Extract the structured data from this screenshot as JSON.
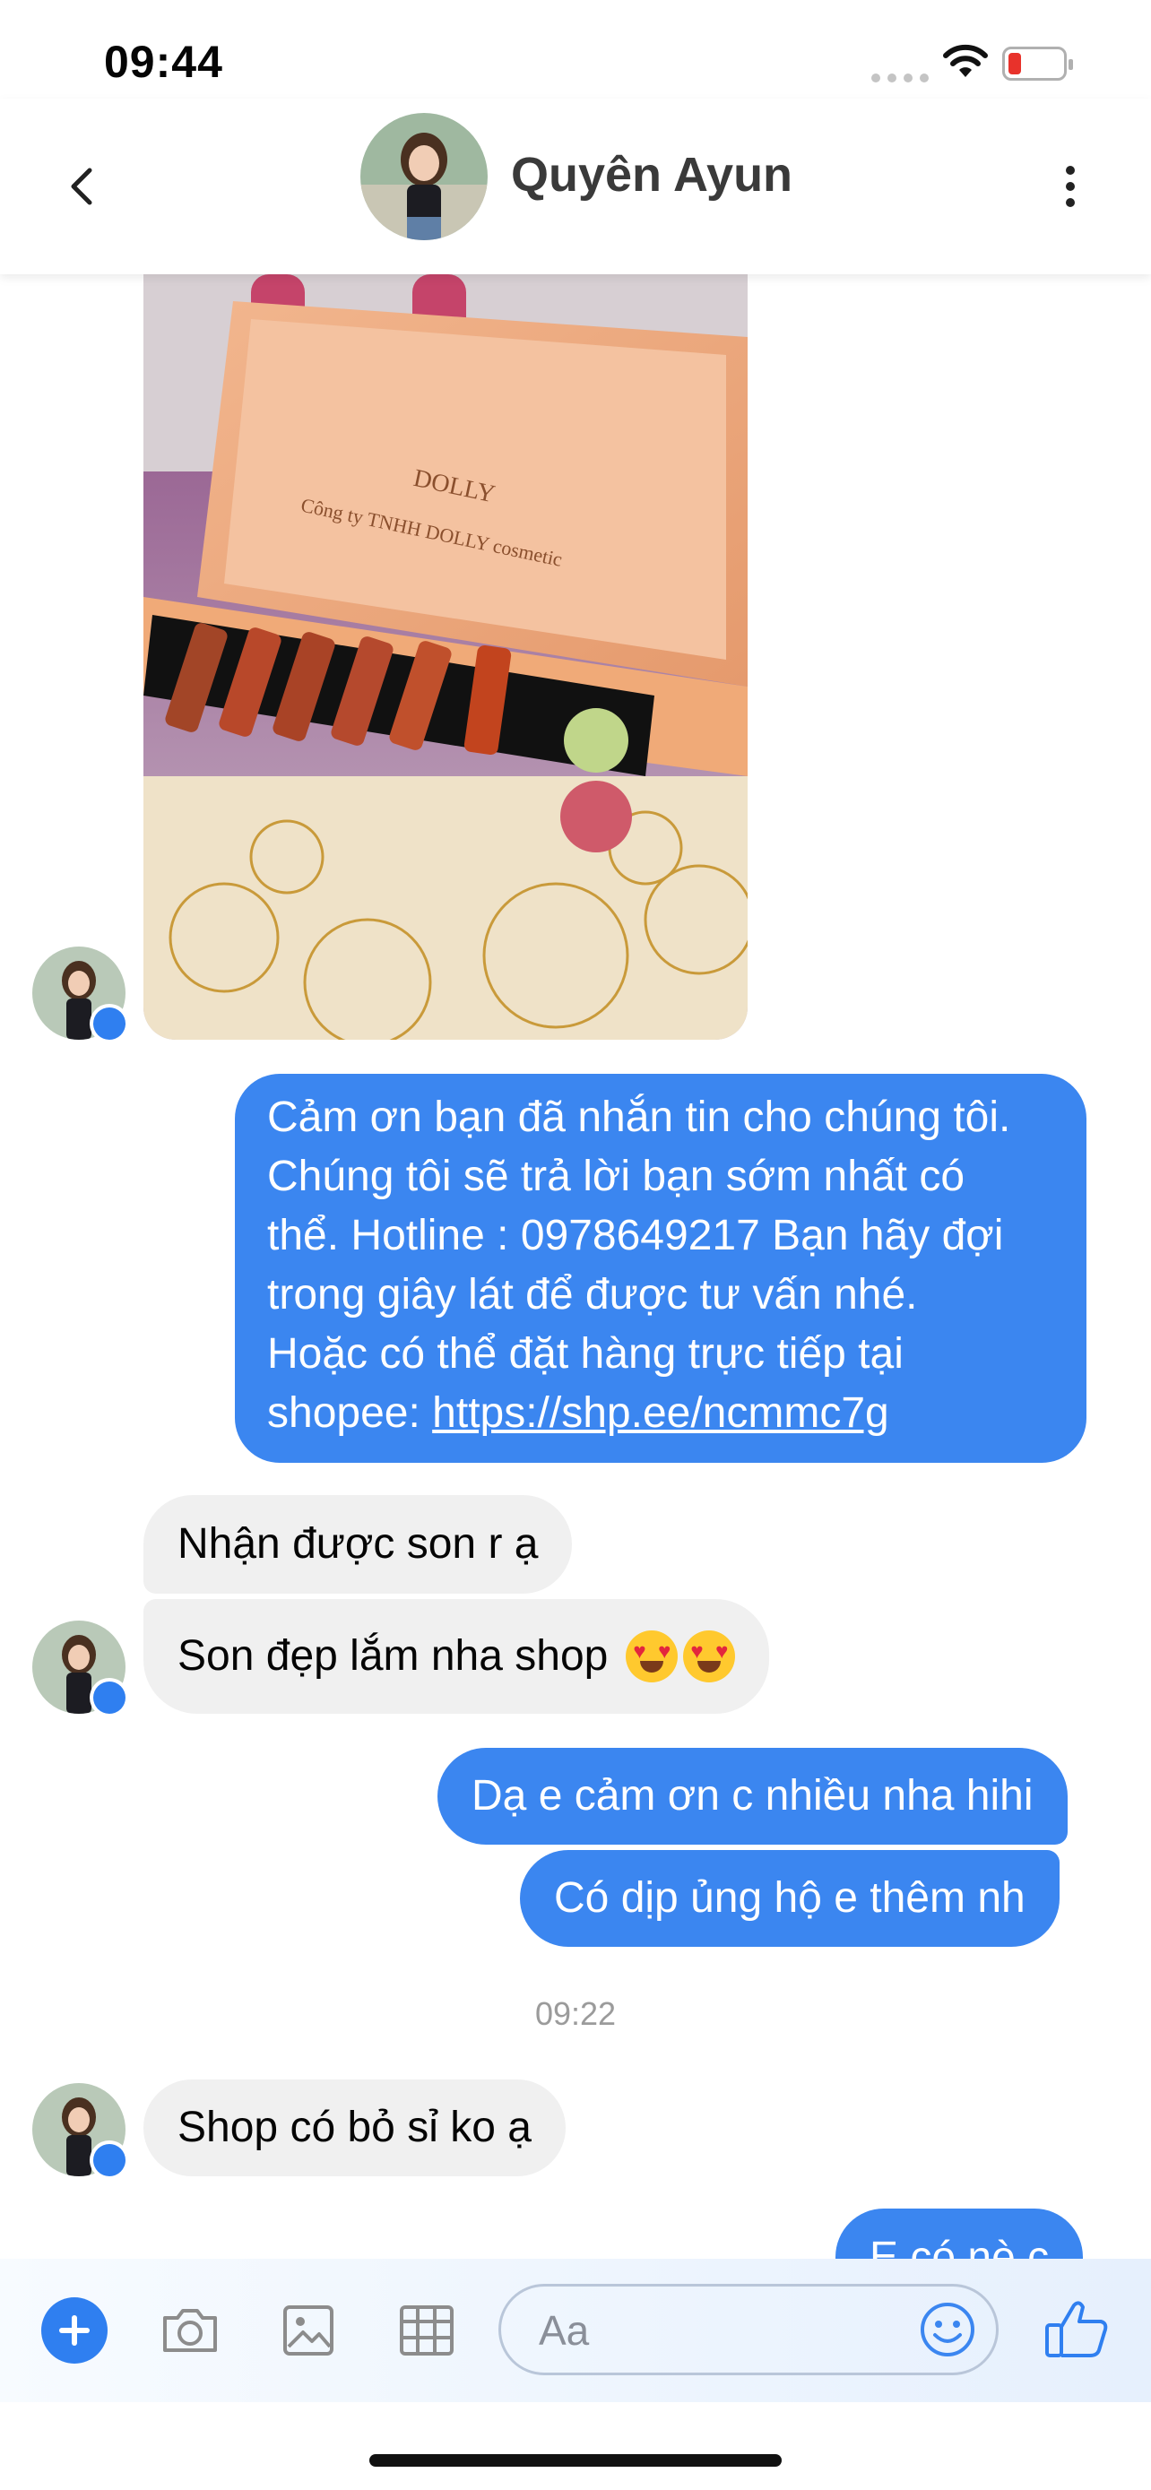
{
  "status_bar": {
    "time": "09:44"
  },
  "header": {
    "contact_name": "Quyên Ayun",
    "back_icon": "chevron-left-icon",
    "more_icon": "vertical-dots-icon"
  },
  "photo": {
    "brand_text": "DOLLY",
    "box_text": "Công ty TNHH DOLLY cosmetic"
  },
  "messages": {
    "m1": {
      "lines": [
        "Cảm ơn bạn đã nhắn tin cho chúng tôi.",
        "Chúng tôi sẽ trả lời bạn sớm nhất có",
        "thể. Hotline : 0978649217 Bạn hãy đợi",
        "trong giây lát để được tư vấn nhé.",
        "Hoặc có thể đặt hàng trực tiếp tại"
      ],
      "link_prefix": "shopee: ",
      "link": "https://shp.ee/ncmmc7g"
    },
    "m2": "Nhận được son r ạ",
    "m3": "Son đẹp lắm nha shop",
    "m4": "Dạ e cảm ơn c nhiều nha hihi",
    "m5": "Có dịp ủng hộ e thêm nh",
    "timestamp": "09:22",
    "m6": "Shop có bỏ sỉ ko ạ",
    "m7": "E có nè c"
  },
  "composer": {
    "placeholder": "Aa",
    "icons": [
      "plus-icon",
      "camera-icon",
      "image-icon",
      "sticker-grid-icon",
      "emoji-icon",
      "thumbs-up-icon"
    ]
  },
  "colors": {
    "outgoing": "#3b86f0",
    "incoming": "#f0f0f0",
    "accent": "#2f7ff0"
  }
}
